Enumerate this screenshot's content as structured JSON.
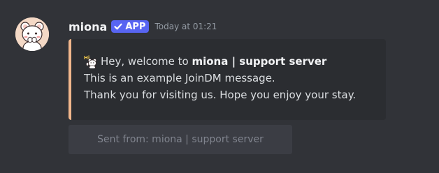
{
  "message": {
    "author": "miona",
    "app_tag": "APP",
    "timestamp": "Today at 01:21",
    "avatar_icon": "white-bear-avatar",
    "embed": {
      "accent_color": "#f2b78c",
      "emoji_icon": "bear-emoji",
      "greeting_prefix": "Hey, welcome to",
      "server_name": "miona | support server",
      "line2": "This is an example JoinDM message.",
      "line3": "Thank you for visiting us. Hope you enjoy your stay."
    },
    "button": {
      "label": "Sent from: miona | support server",
      "disabled": true
    }
  },
  "colors": {
    "background": "#313338",
    "embed_background": "#2b2d31",
    "app_tag": "#5865f2",
    "timestamp": "#949ba4",
    "button_background": "#3b3d44",
    "button_text": "#80848e"
  }
}
